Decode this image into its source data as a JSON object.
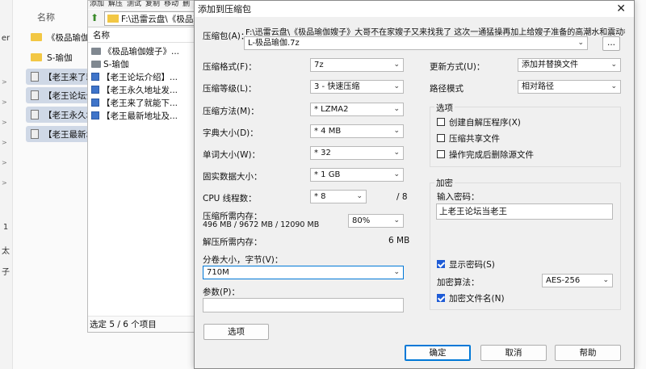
{
  "explorer": {
    "name_header": "名称",
    "left_pane_chars": [
      "er",
      "1",
      "太",
      "子"
    ],
    "rows": [
      {
        "label": "《极品瑜伽嫂子》",
        "icon": "folder-icon",
        "selected": false
      },
      {
        "label": "S-瑜伽",
        "icon": "folder-icon",
        "selected": false
      },
      {
        "label": "【老王来了就",
        "icon": "file-icon",
        "selected": true
      },
      {
        "label": "【老王论坛介",
        "icon": "file-icon",
        "selected": true
      },
      {
        "label": "【老王永久地",
        "icon": "file-icon",
        "selected": true
      },
      {
        "label": "【老王最新地",
        "icon": "file-icon",
        "selected": true
      }
    ]
  },
  "file_manager": {
    "menu": [
      "添加",
      "解压",
      "测试",
      "复制",
      "移动",
      "删"
    ],
    "path": "F:\\迅雷云盘\\《极品瑜",
    "column_header": "名称",
    "rows": [
      {
        "label": "《极品瑜伽嫂子》...",
        "icon": "folder"
      },
      {
        "label": "S-瑜伽",
        "icon": "folder"
      },
      {
        "label": "【老王论坛介绍】...",
        "icon": "doc"
      },
      {
        "label": "【老王永久地址发...",
        "icon": "doc"
      },
      {
        "label": "【老王来了就能下...",
        "icon": "doc"
      },
      {
        "label": "【老王最新地址及...",
        "icon": "doc"
      }
    ],
    "status": "选定 5 / 6 个项目"
  },
  "dialog": {
    "title": "添加到压缩包",
    "archive_label": "压缩包(A)：",
    "archive_path": "F:\\迅雷云盘\\《极品瑜伽嫂子》大哥不在家嫂子又来找我了 这次一通猛操再加上给嫂子准备的高潮水和震动棒",
    "archive_name": "L-极品瑜伽.7z",
    "browse_label": "...",
    "left": [
      {
        "label": "压缩格式(F)：",
        "value": "7z"
      },
      {
        "label": "压缩等级(L)：",
        "value": "3 - 快速压缩"
      },
      {
        "label": "压缩方法(M)：",
        "value": "* LZMA2"
      },
      {
        "label": "字典大小(D)：",
        "value": "* 4 MB"
      },
      {
        "label": "单词大小(W)：",
        "value": "* 32"
      },
      {
        "label": "固实数据大小：",
        "value": "* 1 GB"
      }
    ],
    "cpu_label": "CPU 线程数：",
    "cpu_value": "* 8",
    "cpu_max": "/ 8",
    "mem_compress_label": "压缩所需内存：",
    "mem_compress_detail": "496 MB / 9672 MB / 12090 MB",
    "mem_percent": "80%",
    "mem_decompress_label": "解压所需内存：",
    "mem_decompress_value": "6 MB",
    "volume_label": "分卷大小，字节(V)：",
    "volume_value": "710M",
    "params_label": "参数(P)：",
    "options_button": "选项",
    "update_label": "更新方式(U)：",
    "update_value": "添加并替换文件",
    "pathmode_label": "路径模式",
    "pathmode_value": "相对路径",
    "options_group": "选项",
    "option_sfx": "创建自解压程序(X)",
    "option_shared": "压缩共享文件",
    "option_delete": "操作完成后删除源文件",
    "encrypt_group": "加密",
    "password_label": "输入密码：",
    "password_value": "上老王论坛当老王",
    "show_password": "显示密码(S)",
    "encrypt_method_label": "加密算法：",
    "encrypt_method_value": "AES-256",
    "encrypt_names": "加密文件名(N)",
    "ok": "确定",
    "cancel": "取消",
    "help": "帮助"
  },
  "colors": {
    "accent": "#0078d7",
    "checkbox": "#1e5bd6",
    "folder": "#f2c744",
    "doc": "#3f74c9"
  }
}
